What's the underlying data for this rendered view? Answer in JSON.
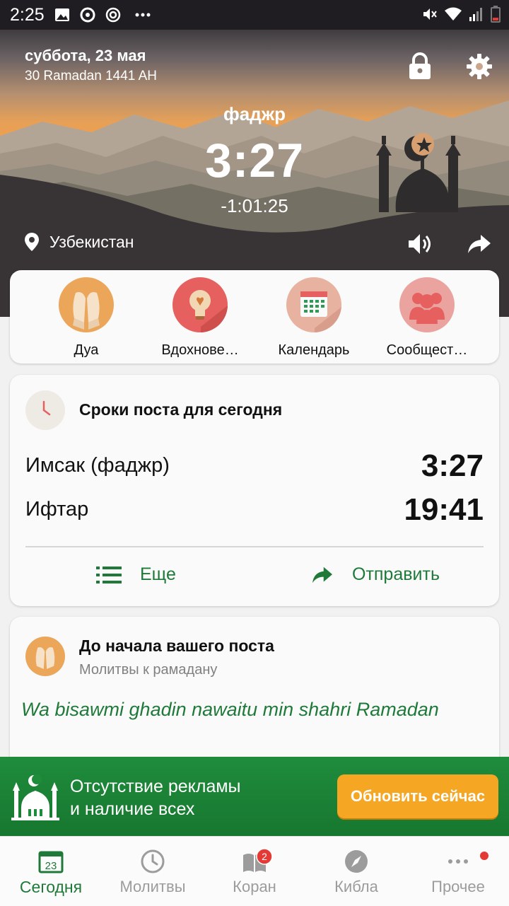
{
  "status_bar": {
    "time": "2:25",
    "icons": [
      "image-icon",
      "sync-icon",
      "target-icon",
      "more-dots-icon"
    ],
    "right_icons": [
      "mute-icon",
      "wifi-icon",
      "signal-icon",
      "battery-icon"
    ]
  },
  "header": {
    "date": "суббота, 23 мая",
    "hijri_date": "30 Ramadan 1441 AH",
    "prayer_name": "фаджр",
    "prayer_time": "3:27",
    "countdown": "-1:01:25",
    "location": "Узбекистан"
  },
  "quick_actions": [
    {
      "label": "Дуа",
      "icon": "praying-hands-icon"
    },
    {
      "label": "Вдохнове…",
      "icon": "lightbulb-icon"
    },
    {
      "label": "Календарь",
      "icon": "calendar-icon"
    },
    {
      "label": "Сообщест…",
      "icon": "community-icon"
    }
  ],
  "fasting_card": {
    "title": "Сроки поста для сегодня",
    "rows": [
      {
        "label": "Имсак (фаджр)",
        "value": "3:27"
      },
      {
        "label": "Ифтар",
        "value": "19:41"
      }
    ],
    "more_label": "Еще",
    "share_label": "Отправить"
  },
  "dua_card": {
    "title": "До начала вашего поста",
    "subtitle": "Молитвы к рамадану",
    "text": "Wa bisawmi ghadin nawaitu min shahri Ramadan"
  },
  "promo": {
    "line1": "Отсутствие рекламы",
    "line2": "и наличие всех",
    "button": "Обновить сейчас"
  },
  "nav": {
    "today_date": "23",
    "quran_badge": "2",
    "items": [
      {
        "label": "Сегодня"
      },
      {
        "label": "Молитвы"
      },
      {
        "label": "Коран"
      },
      {
        "label": "Кибла"
      },
      {
        "label": "Прочее"
      }
    ]
  },
  "colors": {
    "accent_green": "#1f7a3a",
    "promo_button": "#f5a623",
    "badge_red": "#e53935"
  }
}
